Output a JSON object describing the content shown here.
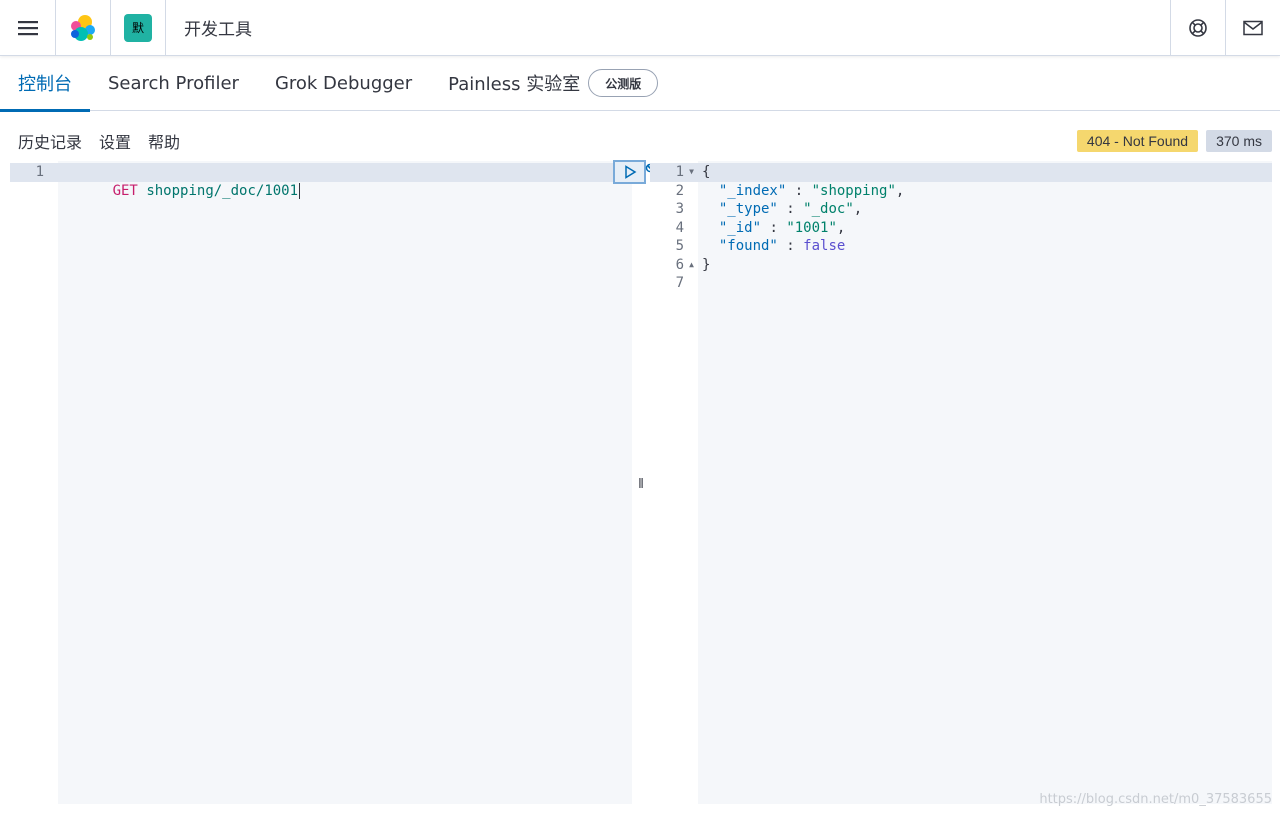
{
  "header": {
    "breadcrumb": "开发工具",
    "space_badge": "默",
    "icons": [
      "menu-icon",
      "elastic-logo-icon",
      "help-icon",
      "mail-icon"
    ]
  },
  "tabs": [
    {
      "label": "控制台",
      "active": true
    },
    {
      "label": "Search Profiler",
      "active": false
    },
    {
      "label": "Grok Debugger",
      "active": false
    },
    {
      "label": "Painless 实验室",
      "active": false
    }
  ],
  "beta_badge": "公测版",
  "subnav": {
    "history": "历史记录",
    "settings": "设置",
    "help": "帮助"
  },
  "status": {
    "code": "404 - Not Found",
    "time": "370 ms",
    "code_color": "#f5d76e"
  },
  "request_editor": {
    "line_numbers": [
      "1"
    ],
    "method": "GET",
    "path": "shopping/_doc/1001"
  },
  "response_editor": {
    "line_numbers": [
      "1",
      "2",
      "3",
      "4",
      "5",
      "6",
      "7"
    ],
    "open_brace": "{",
    "close_brace": "}",
    "fields": [
      {
        "key": "\"_index\"",
        "sep": " : ",
        "value": "\"shopping\"",
        "tail": ","
      },
      {
        "key": "\"_type\"",
        "sep": " : ",
        "value": "\"_doc\"",
        "tail": ","
      },
      {
        "key": "\"_id\"",
        "sep": " : ",
        "value": "\"1001\"",
        "tail": ","
      },
      {
        "key": "\"found\"",
        "sep": " : ",
        "value": "false",
        "tail": ""
      }
    ]
  },
  "resizer_glyph": "‖",
  "watermark": "https://blog.csdn.net/m0_37583655"
}
